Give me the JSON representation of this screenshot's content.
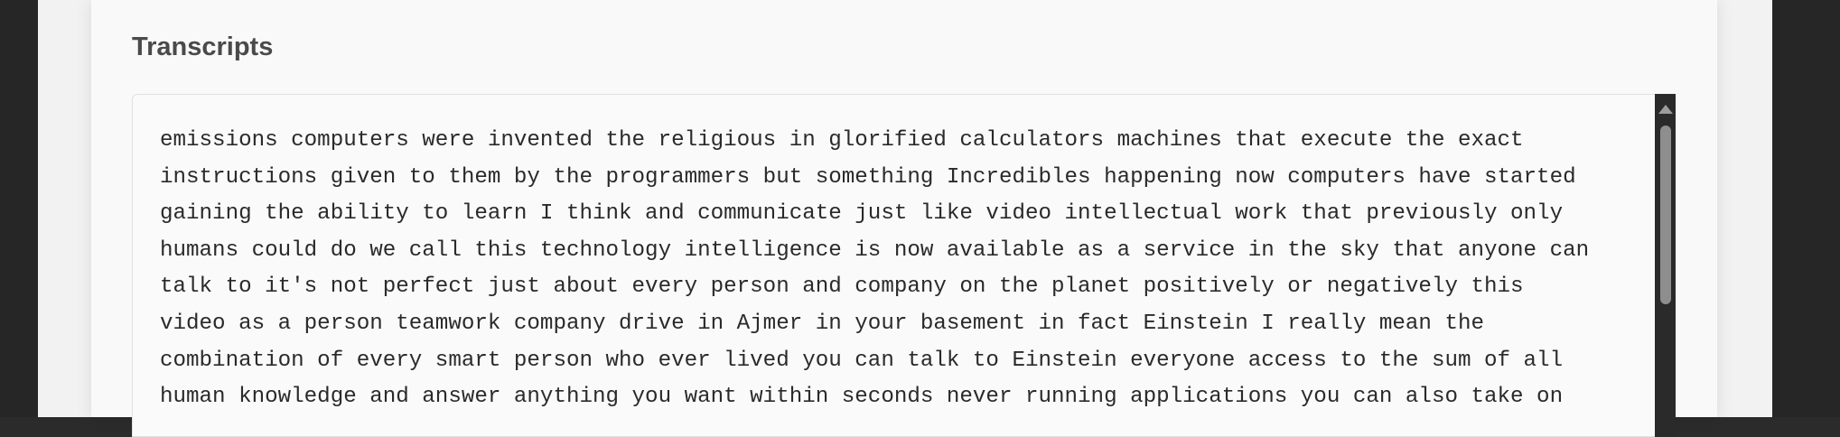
{
  "section": {
    "title": "Transcripts"
  },
  "transcript": {
    "lines": [
      "emissions computers were invented the religious in glorified calculators machines that execute the exact",
      "instructions given to them by the programmers but something Incredibles happening now computers have started",
      "gaining the ability to learn I think and communicate just like video intellectual work that previously only",
      "humans could do we call this technology intelligence is now available as a service in the sky that anyone can",
      "talk to it's not perfect just about every person and company on the planet positively or negatively this",
      "video as a person teamwork company drive in Ajmer in your basement in fact Einstein I really mean the",
      "combination of every smart person who ever lived you can talk to Einstein everyone access to the sum of all",
      "human knowledge and answer anything you want within seconds never running applications you can also take on"
    ]
  },
  "scrollbar": {
    "thumb_color": "#8e8e8e",
    "track_color": "#2a2a2a"
  }
}
